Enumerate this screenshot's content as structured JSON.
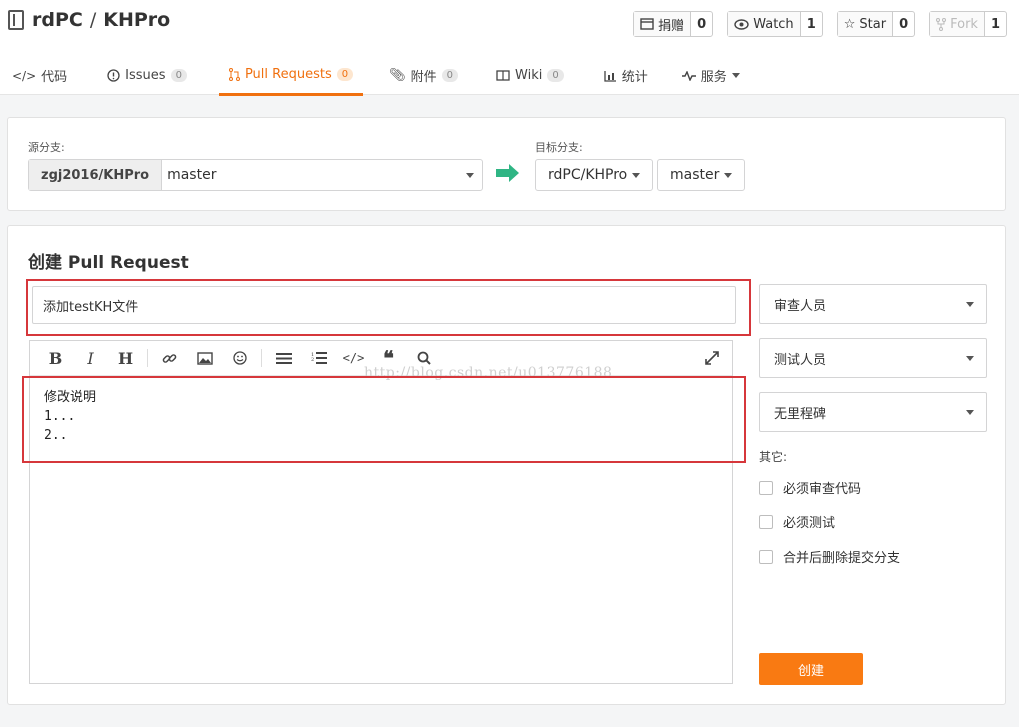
{
  "repo": {
    "owner": "rdPC",
    "sep": "/",
    "name": "KHPro"
  },
  "actions": [
    {
      "label": "捐赠",
      "count": "0",
      "icon": "donate-icon"
    },
    {
      "label": "Watch",
      "count": "1",
      "icon": "eye-icon"
    },
    {
      "label": "Star",
      "count": "0",
      "icon": "star-icon"
    },
    {
      "label": "Fork",
      "count": "1",
      "icon": "fork-icon",
      "disabled": true
    }
  ],
  "tabs": [
    {
      "label": "代码",
      "icon": "code-icon"
    },
    {
      "label": "Issues",
      "badge": "0",
      "icon": "issue-icon"
    },
    {
      "label": "Pull Requests",
      "badge": "0",
      "icon": "pull-request-icon",
      "active": true
    },
    {
      "label": "附件",
      "badge": "0",
      "icon": "paperclip-icon"
    },
    {
      "label": "Wiki",
      "badge": "0",
      "icon": "book-icon"
    },
    {
      "label": "统计",
      "icon": "bar-chart-icon"
    },
    {
      "label": "服务",
      "icon": "pulse-icon"
    }
  ],
  "branch": {
    "source_label": "源分支:",
    "source_owner": "zgj2016/KHPro",
    "source_branch": "master",
    "target_label": "目标分支:",
    "target_repo": "rdPC/KHPro",
    "target_branch": "master"
  },
  "form": {
    "title": "创建 Pull Request",
    "pr_title_value": "添加testKH文件",
    "body_line1": "修改说明",
    "body_line2": "1...",
    "body_line3": "2..",
    "watermark": "http://blog.csdn.net/u013776188"
  },
  "sidebar": {
    "reviewer": "审查人员",
    "tester": "测试人员",
    "milestone": "无里程碑",
    "other_label": "其它:",
    "opt_review": "必须审查代码",
    "opt_test": "必须测试",
    "opt_delete": "合并后删除提交分支",
    "create": "创建"
  },
  "colors": {
    "accent": "#f0700f",
    "button": "#f97a12",
    "highlight_box": "#d6373b",
    "arrow": "#2fb584"
  }
}
